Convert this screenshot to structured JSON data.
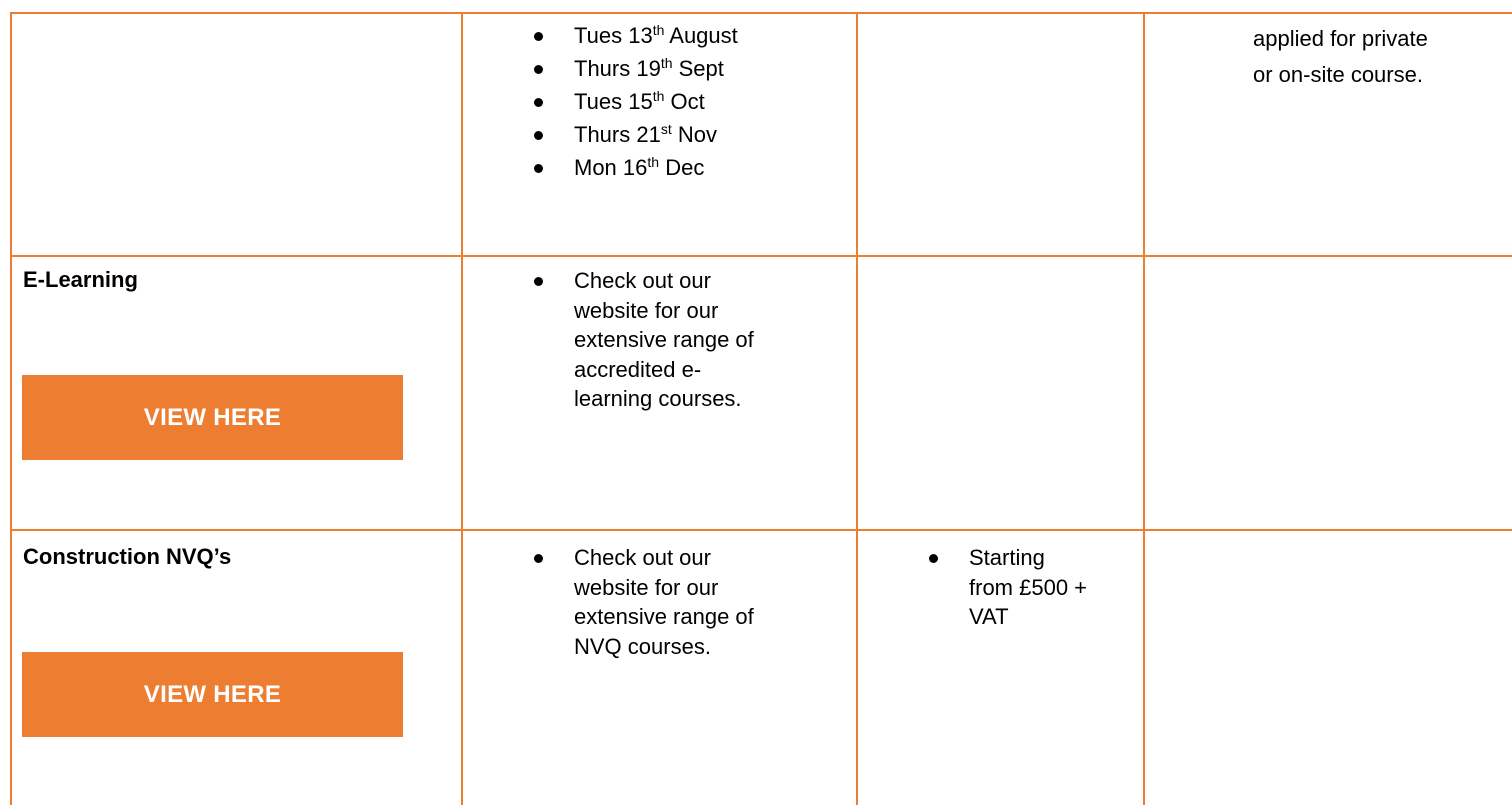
{
  "accent_color": "#ED7D31",
  "row1": {
    "dates": [
      {
        "prefix": "Tues 13",
        "sup": "th",
        "suffix": " August"
      },
      {
        "prefix": "Thurs 19",
        "sup": "th",
        "suffix": " Sept"
      },
      {
        "prefix": "Tues 15",
        "sup": "th",
        "suffix": " Oct"
      },
      {
        "prefix": "Thurs 21",
        "sup": "st",
        "suffix": " Nov"
      },
      {
        "prefix": "Mon 16",
        "sup": "th",
        "suffix": " Dec"
      }
    ],
    "note_lines": [
      "applied for private",
      "or on-site course."
    ]
  },
  "row2": {
    "title": "E-Learning",
    "button_label": "VIEW HERE",
    "description_lines": [
      "Check out our",
      "website for our",
      "extensive range of",
      "accredited e-",
      "learning courses."
    ]
  },
  "row3": {
    "title": "Construction NVQ’s",
    "button_label": "VIEW HERE",
    "description_lines": [
      "Check out our",
      "website for our",
      "extensive range of",
      "NVQ courses."
    ],
    "price_lines": [
      "Starting",
      "from £500 +",
      "VAT"
    ]
  }
}
